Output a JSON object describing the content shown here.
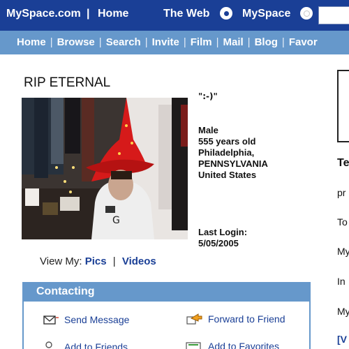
{
  "topbar": {
    "brand": "MySpace.com",
    "separator": "|",
    "home": "Home",
    "the_web": "The Web",
    "myspace": "MySpace"
  },
  "nav": {
    "items": [
      "Home",
      "Browse",
      "Search",
      "Invite",
      "Film",
      "Mail",
      "Blog",
      "Favor"
    ]
  },
  "profile": {
    "name": "RIP ETERNAL",
    "mood": "\":-)\"",
    "gender": "Male",
    "age": "555 years old",
    "city": "Philadelphia,",
    "state": "PENNSYLVANIA",
    "country": "United States",
    "last_login_label": "Last Login:",
    "last_login_date": "5/05/2005",
    "photo_icon": "profile-photo"
  },
  "view_my": {
    "label": "View My:",
    "pics": "Pics",
    "separator": "|",
    "videos": "Videos"
  },
  "contacting": {
    "title": "Contacting",
    "send_message": "Send Message",
    "forward_to_friend": "Forward to Friend",
    "add_to_friends": "Add to Friends",
    "add_to_favorites": "Add to Favorites"
  },
  "right_column": {
    "frag1": "Te",
    "frag2": "pr",
    "frag3": "To",
    "frag4": "My",
    "frag5": "In",
    "frag6": "My",
    "frag7": "[V"
  },
  "colors": {
    "topbar": "#1a3f96",
    "navbar": "#6698cb",
    "link": "#1a3f96"
  }
}
